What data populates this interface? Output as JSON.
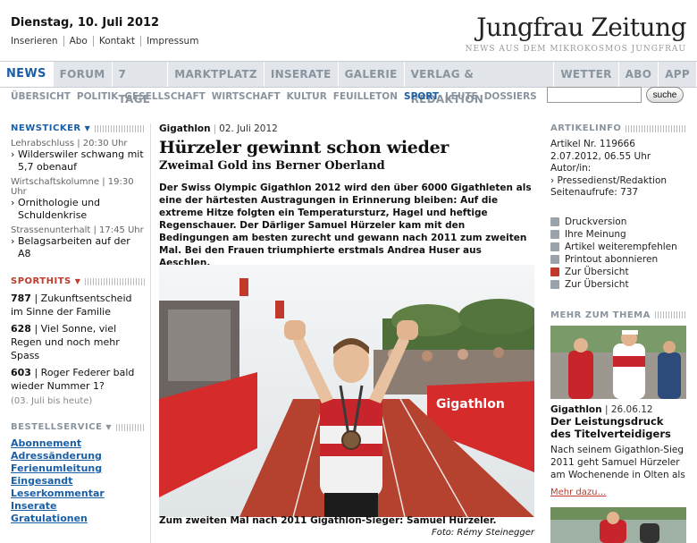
{
  "header": {
    "date": "Dienstag, 10. Juli 2012",
    "toplinks": [
      "Inserieren",
      "Abo",
      "Kontakt",
      "Impressum"
    ],
    "logo": "Jungfrau Zeitung",
    "tagline": "NEWS AUS DEM MIKROKOSMOS JUNGFRAU"
  },
  "mainnav": [
    "NEWS",
    "FORUM",
    "7 TAGE",
    "MARKTPLATZ",
    "INSERATE",
    "GALERIE",
    "VERLAG & REDAKTION",
    "WETTER",
    "ABO",
    "APP"
  ],
  "mainnav_active": 0,
  "subnav": [
    "ÜBERSICHT",
    "POLITIK",
    "GESELLSCHAFT",
    "WIRTSCHAFT",
    "KULTUR",
    "FEUILLETON",
    "SPORT",
    "LEUTE",
    "DOSSIERS"
  ],
  "subnav_active": 6,
  "search": {
    "value": "",
    "button": "suche"
  },
  "newsticker": {
    "title": "NEWSTICKER",
    "items": [
      {
        "category": "Lehrabschluss | 20:30 Uhr",
        "text": "Wilderswiler schwang mit 5,7 obenauf"
      },
      {
        "category": "Wirtschaftskolumne | 19:30 Uhr",
        "text": "Ornithologie und Schuldenkrise"
      },
      {
        "category": "Strassenunterhalt | 17:45 Uhr",
        "text": "Belagsarbeiten auf der A8"
      }
    ]
  },
  "sporthits": {
    "title": "SPORTHITS",
    "items": [
      {
        "count": "787",
        "text": " | Zukunftsentscheid im Sinne der Familie"
      },
      {
        "count": "628",
        "text": " | Viel Sonne, viel Regen und noch mehr Spass"
      },
      {
        "count": "603",
        "text": " | Roger Federer bald wieder Nummer 1?"
      }
    ],
    "note": "(03. Juli bis heute)"
  },
  "bestellservice": {
    "title": "BESTELLSERVICE",
    "links": [
      "Abonnement",
      "Adressänderung",
      "Ferienumleitung",
      "Eingesandt",
      "Leserkommentar",
      "Inserate",
      "Gratulationen"
    ]
  },
  "article": {
    "kicker": "Gigathlon",
    "date": "02. Juli 2012",
    "headline": "Hürzeler gewinnt schon wieder",
    "subhead": "Zweimal Gold ins Berner Oberland",
    "lead": "Der Swiss Olympic Gigathlon 2012 wird den über 6000 Gigathleten als eine der härtesten Austragungen in Erinnerung bleiben: Auf die extreme Hitze folgten ein Temperatursturz, Hagel und heftige Regenschauer. Der Därliger Samuel Hürzeler kam mit den Bedingungen am besten zurecht und gewann nach 2011 zum zweiten Mal. Bei den Frauen triumphierte erstmals Andrea Huser aus Aeschlen.",
    "caption": "Zum zweiten Mal nach 2011 Gigathlon-Sieger: Samuel Hürzeler.",
    "credit": "Foto: Rémy Steinegger",
    "banner_text": "Gigathlon"
  },
  "artikelinfo": {
    "title": "ARTIKELINFO",
    "lines": [
      "Artikel Nr. 119666",
      "2.07.2012, 06.55 Uhr",
      "Autor/in:",
      "› Pressedienst/Redaktion",
      "Seitenaufrufe: 737"
    ],
    "actions": [
      {
        "label": "Druckversion",
        "icon": "printer-icon"
      },
      {
        "label": "Ihre Meinung",
        "icon": "comment-icon"
      },
      {
        "label": "Artikel weiterempfehlen",
        "icon": "mail-icon"
      },
      {
        "label": "Printout abonnieren",
        "icon": "subscribe-icon"
      },
      {
        "label": "Zur Übersicht",
        "icon": "arrow-left-icon"
      },
      {
        "label": "Zur Übersicht",
        "icon": "arrow-right-icon"
      }
    ]
  },
  "related": {
    "title": "MEHR ZUM THEMA",
    "kicker": "Gigathlon",
    "date": "26.06.12",
    "headline": "Der Leistungsdruck des Titelverteidigers",
    "text": "Nach seinem Gigathlon-Sieg 2011 geht Samuel Hürzeler am Wochenende in Olten als",
    "more": "Mehr dazu…"
  },
  "colors": {
    "accent": "#1b5fa6",
    "red": "#c0392b",
    "nav_gray": "#8a949e"
  }
}
